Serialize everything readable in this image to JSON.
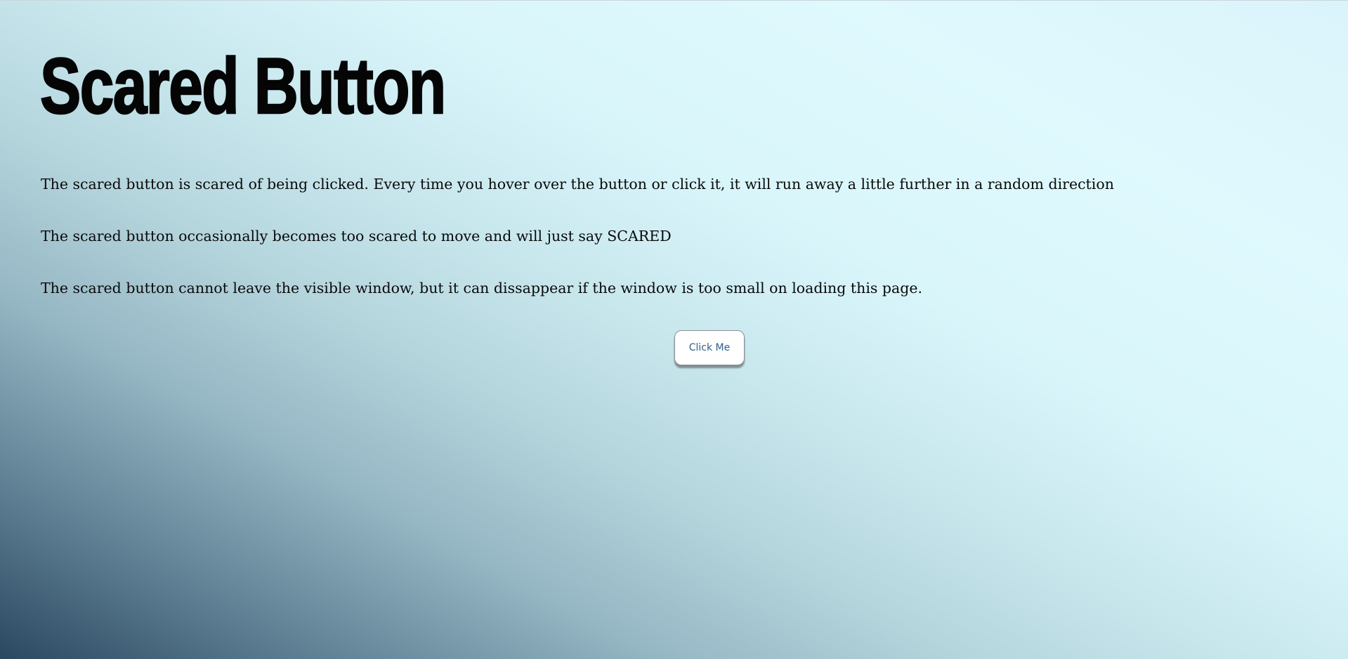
{
  "page": {
    "title": "Scared Button",
    "paragraphs": [
      "The scared button is scared of being clicked. Every time you hover over the button or click it, it will run away a little further in a random direction",
      "The scared button occasionally becomes too scared to move and will just say SCARED",
      "The scared button cannot leave the visible window, but it can dissappear if the window is too small on loading this page."
    ]
  },
  "button": {
    "label": "Click Me"
  },
  "colors": {
    "background_light": "#dff9fd",
    "background_dark": "#2b4861",
    "button_text": "#2f5f8a",
    "button_background": "#ffffff",
    "text": "#0a0a0a"
  }
}
